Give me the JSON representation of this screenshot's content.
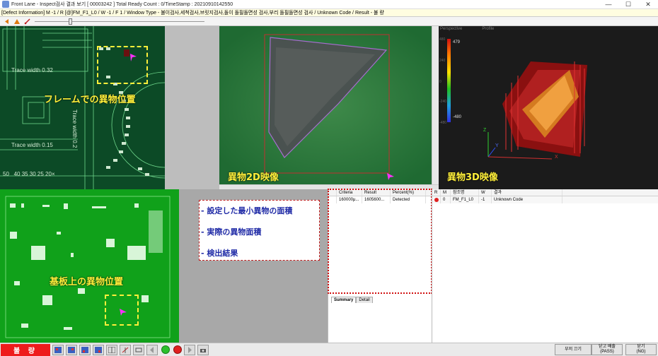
{
  "window": {
    "title": "Front Lane - Inspect검사 결과 보기 [ 00003242 ] Total Ready Count : 0/TimeStamp : 20210910142550",
    "minimize": "—",
    "maximize": "☐",
    "close": "✕"
  },
  "defect_info": "[Defect Information] M -1 / R [@]FM_F1_L0 / W -1 / F 1 / Window Type - 불이검사,세척검사,브릿지검사,돌이 돌필돌면성 검사,부리 돌필돌면성 검사 / Unknown Code / Result - 불 량",
  "frame_panel": {
    "label": "フレームでの異物位置",
    "trace1": "Trace width 0.32",
    "trace2": "Trace width 0.2",
    "trace3": "Trace width 0.15",
    "ruler": "50   40 35 30 25 20×"
  },
  "view2d": {
    "label": "異物2D映像"
  },
  "view3d": {
    "label": "異物3D映像",
    "mode1": "Perspective",
    "mode2": "Profile",
    "scale_top": "479",
    "scale_bottom": "-480",
    "axis_top": "480",
    "axis_mid1": "240",
    "axis_mid2": "0",
    "axis_mid3": "-240",
    "axis_bottom": "-480",
    "z": "Z",
    "y": "Y",
    "x": "X"
  },
  "board_panel": {
    "label": "基板上の異物位置"
  },
  "legend": {
    "item1": "- 設定した最小異物の面積",
    "item2": "- 実際の異物面積",
    "item3": "- 検出結果"
  },
  "summary_grid": {
    "headers": [
      "Criteria",
      "Result",
      "Percent(%)"
    ],
    "row": [
      "160000μ...",
      "1605600...",
      "Detected"
    ]
  },
  "tabs": [
    "Summary",
    "Detail"
  ],
  "defect_grid": {
    "headers": [
      "R",
      "M",
      "참조명",
      "W",
      "결과"
    ],
    "row": [
      "",
      "0",
      "FM_F1_L0",
      "-1",
      "Unknown Code"
    ]
  },
  "status": {
    "ng_text": "불 량",
    "btn_close_jig": "부저 끄기",
    "btn_pass_1": "닫고 배출",
    "btn_pass_2": "(PASS)",
    "btn_ng_1": "닫기",
    "btn_ng_2": "(NG)"
  },
  "colors": {
    "ng_red": "#ee1c1c",
    "overlay_yellow": "#ffef3a",
    "legend_blue": "#1f2aa6",
    "pcb_dark": "#0c4a26",
    "pcb_bright": "#10a11a"
  }
}
